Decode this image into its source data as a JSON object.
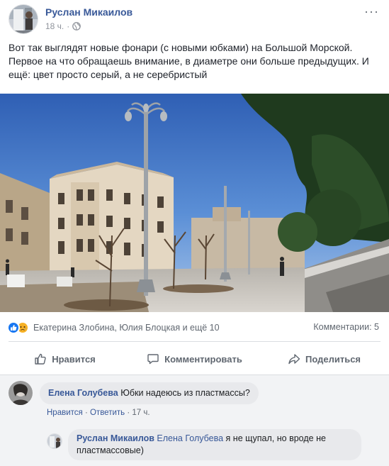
{
  "post": {
    "author": "Руслан Микаилов",
    "time": "18 ч.",
    "separator": "·",
    "more_label": "···",
    "text": "Вот так выглядят новые фонари (с новыми юбками) на Большой Морской. Первое на что обращаешь внимание, в диаметре они больше предыдущих. И ещё: цвет просто серый, а не серебристый"
  },
  "reactions": {
    "icons": [
      "like-icon",
      "sad-icon"
    ],
    "colors": {
      "like": "#1877f2",
      "sad": "#f7b125"
    },
    "reactors": "Екатерина Злобина, Юлия Блоцкая и ещё 10",
    "comments": "Комментарии: 5"
  },
  "actions": {
    "like": "Нравится",
    "comment": "Комментировать",
    "share": "Поделиться"
  },
  "comments": [
    {
      "author": "Елена Голубева",
      "text": "Юбки надеюсь из пластмассы?",
      "like": "Нравится",
      "reply": "Ответить",
      "time": "17 ч."
    }
  ],
  "replies": [
    {
      "author": "Руслан Микаилов",
      "mention": "Елена Голубева",
      "text": "я не щупал, но вроде не пластмассовые)"
    }
  ],
  "colors": {
    "link": "#385898",
    "secondary_text": "#606770",
    "bubble": "#e8e9ec",
    "comments_bg": "#f2f3f5"
  }
}
